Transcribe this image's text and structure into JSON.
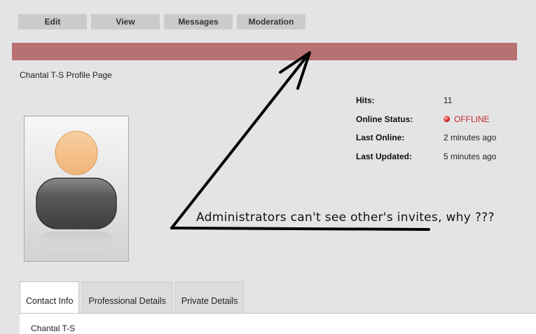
{
  "toolbar": {
    "edit": "Edit",
    "view": "View",
    "messages": "Messages",
    "moderation": "Moderation"
  },
  "page_title": "Chantal T-S Profile Page",
  "stats": {
    "hits_label": "Hits:",
    "hits_value": "11",
    "online_status_label": "Online Status:",
    "online_status_value": "OFFLINE",
    "last_online_label": "Last Online:",
    "last_online_value": "2 minutes ago",
    "last_updated_label": "Last Updated:",
    "last_updated_value": "5 minutes ago"
  },
  "annotation": {
    "text": "Administrators can't see other's invites, why ???"
  },
  "tabs": [
    {
      "label": "Contact Info",
      "active": true
    },
    {
      "label": "Professional Details",
      "active": false
    },
    {
      "label": "Private Details",
      "active": false
    }
  ],
  "panel": {
    "name": "Chantal T-S"
  },
  "colors": {
    "banner": "#b87172",
    "offline": "#c1272d"
  },
  "icons": {
    "avatar": "user-silhouette-icon",
    "status": "status-dot-icon"
  }
}
